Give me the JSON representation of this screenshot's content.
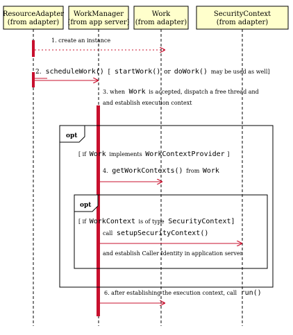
{
  "participants": [
    {
      "name": "ResourceAdapter",
      "origin": "(from adapter)"
    },
    {
      "name": "WorkManager",
      "origin": "(from app server)"
    },
    {
      "name": "Work",
      "origin": "(from adapter)"
    },
    {
      "name": "SecurityContext",
      "origin": "(from adapter)"
    }
  ],
  "messages": {
    "m1": "1. create an instance",
    "m2_prefix": "2.",
    "m2_call": "scheduleWork()",
    "m2_bracket_open": "[",
    "m2_start": "startWork()",
    "m2_or": "or",
    "m2_do": "doWork()",
    "m2_suffix": "may be used as well]",
    "m3_line1_a": "3. when",
    "m3_line1_work": "Work",
    "m3_line1_b": "is accepted, dispatch a free thread  and",
    "m3_line2": "and  establish execution context",
    "m4_prefix": "4.",
    "m4_call": "getWorkContexts()",
    "m4_from": "from",
    "m4_work": "Work",
    "m5_call_prefix": "call",
    "m5_call": "setupSecurityContext()",
    "m5_line2": "and  establish Caller Identity in application server",
    "m6_text": "6. after establishing the execution context, call",
    "m6_call": "run()"
  },
  "fragments": {
    "outer_label": "opt",
    "outer_guard_a": "[ if",
    "outer_guard_work": "Work",
    "outer_guard_b": "implements",
    "outer_guard_type": "WorkContextProvider",
    "outer_guard_c": "]",
    "inner_label": "opt",
    "inner_guard_a": "[ if",
    "inner_guard_wc": "WorkContext",
    "inner_guard_b": "is of type",
    "inner_guard_type": "SecurityContext]"
  },
  "colors": {
    "accent": "#c8102e",
    "participant_fill": "#ffffcc",
    "line": "#000000"
  }
}
